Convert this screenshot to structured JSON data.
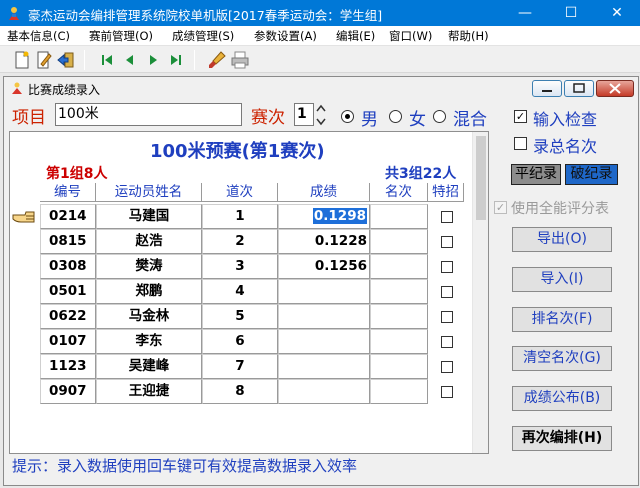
{
  "window": {
    "title": "豪杰运动会编排管理系统院校单机版[2017春季运动会：学生组]",
    "min_glyph": "—",
    "max_glyph": "☐",
    "close_glyph": "✕"
  },
  "menu": [
    "基本信息(C)",
    "赛前管理(O)",
    "成绩管理(S)",
    "参数设置(A)",
    "编辑(E)",
    "窗口(W)",
    "帮助(H)"
  ],
  "toolbar_icons": [
    "new-icon",
    "edit-icon",
    "exit-icon",
    "first-record-icon",
    "prev-record-icon",
    "next-record-icon",
    "last-record-icon",
    "brush-icon",
    "print-icon"
  ],
  "child_window": {
    "title": "比赛成绩录入"
  },
  "entry": {
    "event_label": "项目",
    "event_value": "100米",
    "round_label": "赛次",
    "round_value": "1",
    "gender_options": [
      "男",
      "女",
      "混合"
    ],
    "gender_selected": 0
  },
  "options": {
    "input_check_label": "输入检查",
    "input_check_checked": true,
    "record_rank_label": "录总名次",
    "record_rank_checked": false,
    "all_round_label": "使用全能评分表",
    "all_round_checked": true,
    "tie_record_label": "平纪录",
    "break_record_label": "破纪录"
  },
  "results": {
    "heading": "100米预赛(第1赛次)",
    "group_label": "第1组8人",
    "total_label": "共3组22人",
    "columns": [
      "编号",
      "运动员姓名",
      "道次",
      "成绩",
      "名次",
      "特招"
    ],
    "rows": [
      {
        "num": "0214",
        "name": "马建国",
        "lane": "1",
        "score": "0.1298",
        "rank": "",
        "special": false
      },
      {
        "num": "0815",
        "name": "赵浩",
        "lane": "2",
        "score": "0.1228",
        "rank": "",
        "special": false
      },
      {
        "num": "0308",
        "name": "樊涛",
        "lane": "3",
        "score": "0.1256",
        "rank": "",
        "special": false
      },
      {
        "num": "0501",
        "name": "郑鹏",
        "lane": "4",
        "score": "",
        "rank": "",
        "special": false
      },
      {
        "num": "0622",
        "name": "马金林",
        "lane": "5",
        "score": "",
        "rank": "",
        "special": false
      },
      {
        "num": "0107",
        "name": "李东",
        "lane": "6",
        "score": "",
        "rank": "",
        "special": false
      },
      {
        "num": "1123",
        "name": "吴建峰",
        "lane": "7",
        "score": "",
        "rank": "",
        "special": false
      },
      {
        "num": "0907",
        "name": "王迎捷",
        "lane": "8",
        "score": "",
        "rank": "",
        "special": false
      }
    ]
  },
  "buttons": {
    "export": "导出(O)",
    "import": "导入(I)",
    "rank": "排名次(F)",
    "clear_rank": "清空名次(G)",
    "publish": "成绩公布(B)",
    "rearrange": "再次编排(H)"
  },
  "hint": "提示：录入数据使用回车键可有效提高数据录入效率",
  "colors": {
    "titlebar": "#0078d7",
    "label_blue": "#1f3fbf",
    "label_red": "#cc2200",
    "selection": "#1e6fd9"
  }
}
